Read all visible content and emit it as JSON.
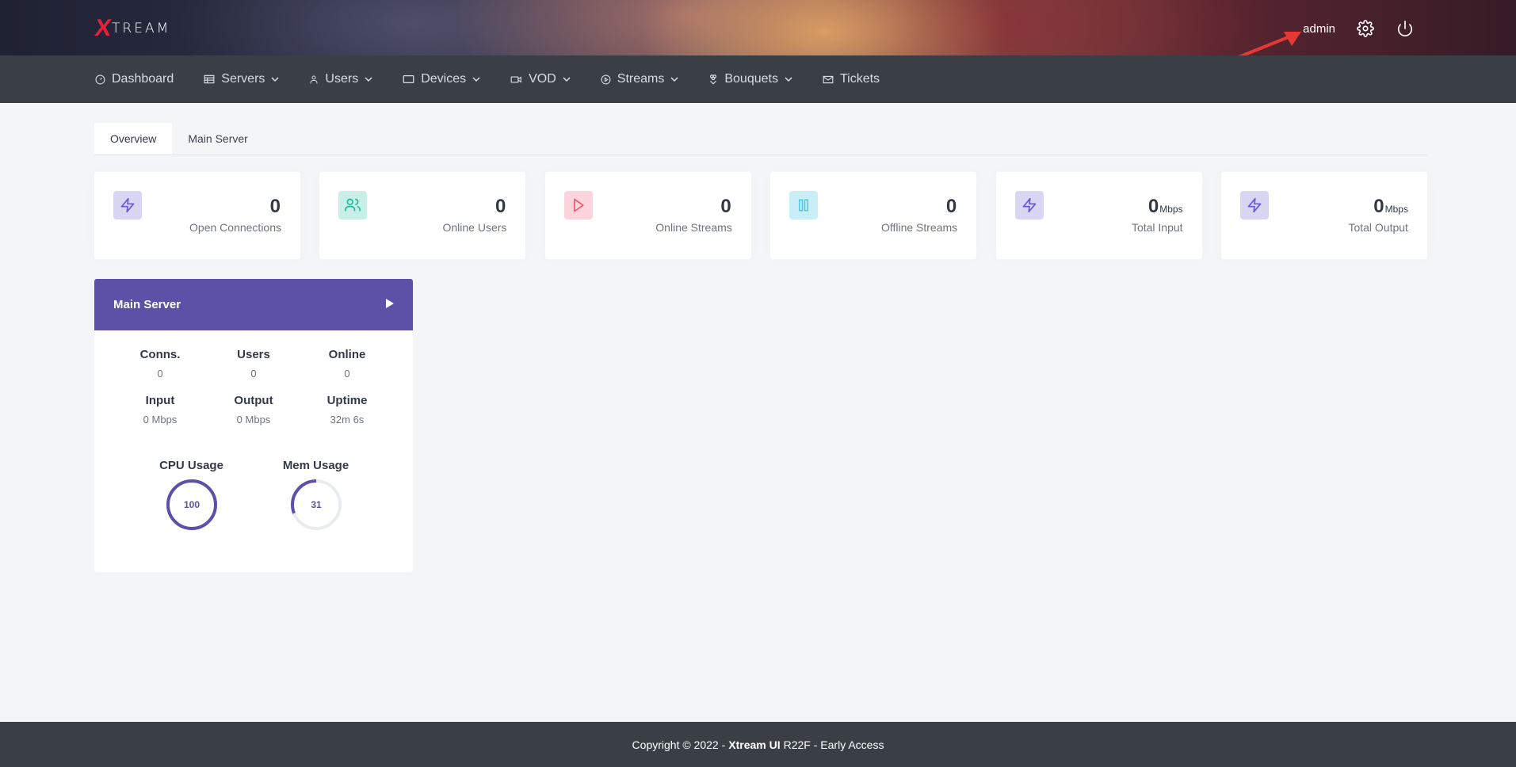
{
  "brand": {
    "logo_x": "X",
    "logo_text": "TREAM"
  },
  "header": {
    "username": "admin"
  },
  "nav": {
    "dashboard": "Dashboard",
    "servers": "Servers",
    "users": "Users",
    "devices": "Devices",
    "vod": "VOD",
    "streams": "Streams",
    "bouquets": "Bouquets",
    "tickets": "Tickets"
  },
  "tabs": {
    "overview": "Overview",
    "main_server": "Main Server"
  },
  "stats": [
    {
      "value": "0",
      "unit": "",
      "label": "Open Connections",
      "color": "#6658dd"
    },
    {
      "value": "0",
      "unit": "",
      "label": "Online Users",
      "color": "#1abc9c"
    },
    {
      "value": "0",
      "unit": "",
      "label": "Online Streams",
      "color": "#f1556c"
    },
    {
      "value": "0",
      "unit": "",
      "label": "Offline Streams",
      "color": "#4fc6e1"
    },
    {
      "value": "0",
      "unit": "Mbps",
      "label": "Total Input",
      "color": "#6658dd"
    },
    {
      "value": "0",
      "unit": "Mbps",
      "label": "Total Output",
      "color": "#6658dd"
    }
  ],
  "server": {
    "title": "Main Server",
    "conns_label": "Conns.",
    "conns": "0",
    "users_label": "Users",
    "users": "0",
    "online_label": "Online",
    "online": "0",
    "input_label": "Input",
    "input": "0 Mbps",
    "output_label": "Output",
    "output": "0 Mbps",
    "uptime_label": "Uptime",
    "uptime": "32m 6s",
    "cpu_label": "CPU Usage",
    "cpu": 100,
    "mem_label": "Mem Usage",
    "mem": 31,
    "gauge_color": "#5b51a6"
  },
  "footer": {
    "prefix": "Copyright © 2022 -",
    "brand": "Xtream UI",
    "suffix": "R22F - Early Access"
  }
}
